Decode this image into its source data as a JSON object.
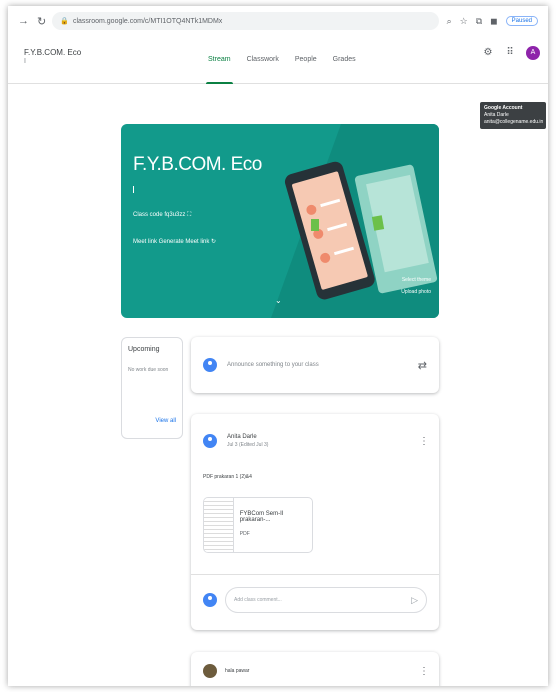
{
  "browser": {
    "url": "classroom.google.com/c/MTI1OTQ4NTk1MDMx",
    "paused_label": "Paused"
  },
  "header": {
    "class_title": "F.Y.B.COM. Eco",
    "class_sub": "I",
    "tabs": [
      "Stream",
      "Classwork",
      "People",
      "Grades"
    ],
    "avatar_letter": "A"
  },
  "tooltip": {
    "title": "Google Account",
    "name": "Anita Darle",
    "email": "anita@collegename.edu.in"
  },
  "banner": {
    "title": "F.Y.B.COM. Eco",
    "class_code": "Class code  fq3u3zz",
    "meet_link": "Meet link  Generate Meet link",
    "chevron": "⌄",
    "select_theme": "Select theme",
    "upload_photo": "Upload photo",
    "colors": {
      "teal": "#129a8b"
    }
  },
  "upcoming": {
    "title": "Upcoming",
    "no_work": "No work due soon",
    "view_all": "View all"
  },
  "announce": {
    "placeholder": "Announce something to your class"
  },
  "post": {
    "author": "Anita Darle",
    "date": "Jul 3 (Edited Jul 3)",
    "body": "PDF prakaran 1 (2)&4",
    "attachment_name": "FYBCom Sem-II prakaran-...",
    "attachment_type": "PDF",
    "comment_placeholder": "Add class comment..."
  },
  "post2": {
    "author": "hala pawar"
  }
}
